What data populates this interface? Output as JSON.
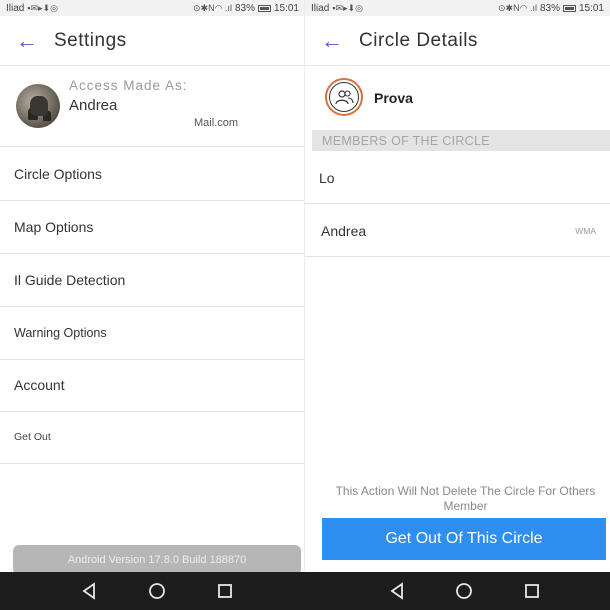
{
  "statusbar": {
    "carrier": "Iliad",
    "battery": "83%",
    "time": "15:01"
  },
  "settings": {
    "title": "Settings",
    "account_label": "Access Made As:",
    "user_name": "Andrea",
    "user_mail": "Mail.com",
    "menu": [
      {
        "label": "Circle Options"
      },
      {
        "label": "Map Options"
      },
      {
        "label": "Il Guide Detection"
      },
      {
        "label": "Warning Options"
      },
      {
        "label": "Account"
      },
      {
        "label": "Get Out"
      }
    ],
    "version": "Android Version 17.8.0 Build 188870"
  },
  "circle_details": {
    "title": "Circle Details",
    "circle_name": "Prova",
    "section_header": "MEMBERS OF THE CIRCLE",
    "members": [
      {
        "name": "Lo",
        "tag": ""
      },
      {
        "name": "Andrea",
        "tag": "WMA"
      }
    ],
    "warning": "This Action Will Not Delete The Circle For Others Member",
    "leave_button": "Get Out Of This Circle"
  },
  "colors": {
    "accent": "#6a45c7",
    "button_blue": "#2e8ff0",
    "circle_ring": "#d9713f"
  }
}
